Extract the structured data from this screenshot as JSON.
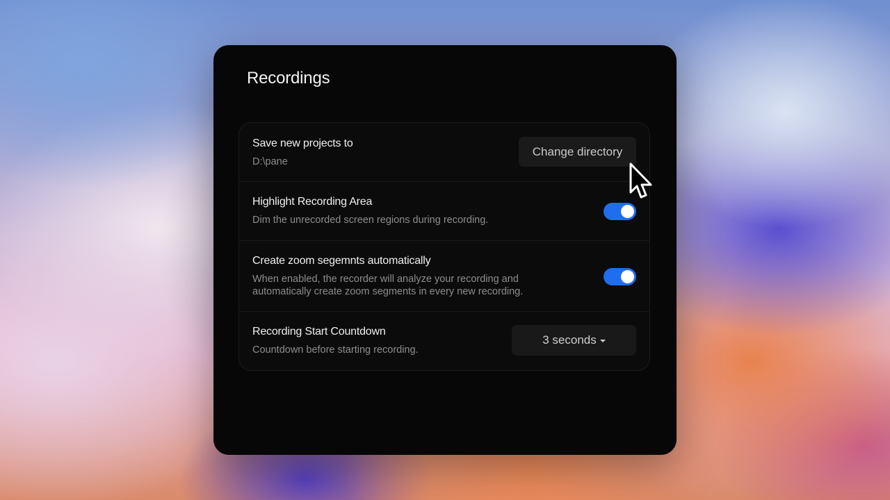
{
  "window": {
    "title": "Recordings"
  },
  "settings": {
    "save_location": {
      "label": "Save new projects to",
      "value": "D:\\pane",
      "button_label": "Change directory"
    },
    "highlight_area": {
      "label": "Highlight Recording Area",
      "description": "Dim the unrecorded screen regions during recording.",
      "enabled": true
    },
    "auto_zoom": {
      "label": "Create zoom segemnts automatically",
      "description": "When enabled, the recorder will analyze your recording and automatically create zoom segments in every new recording.",
      "enabled": true
    },
    "countdown": {
      "label": "Recording Start Countdown",
      "description": "Countdown before starting recording.",
      "selected": "3 seconds"
    }
  },
  "colors": {
    "toggle_on": "#1f6ef0",
    "panel_bg": "#070707",
    "card_bg": "#0b0b0b"
  },
  "icons": {
    "cursor": "mouse-pointer-icon",
    "dropdown": "caret-down-icon"
  }
}
